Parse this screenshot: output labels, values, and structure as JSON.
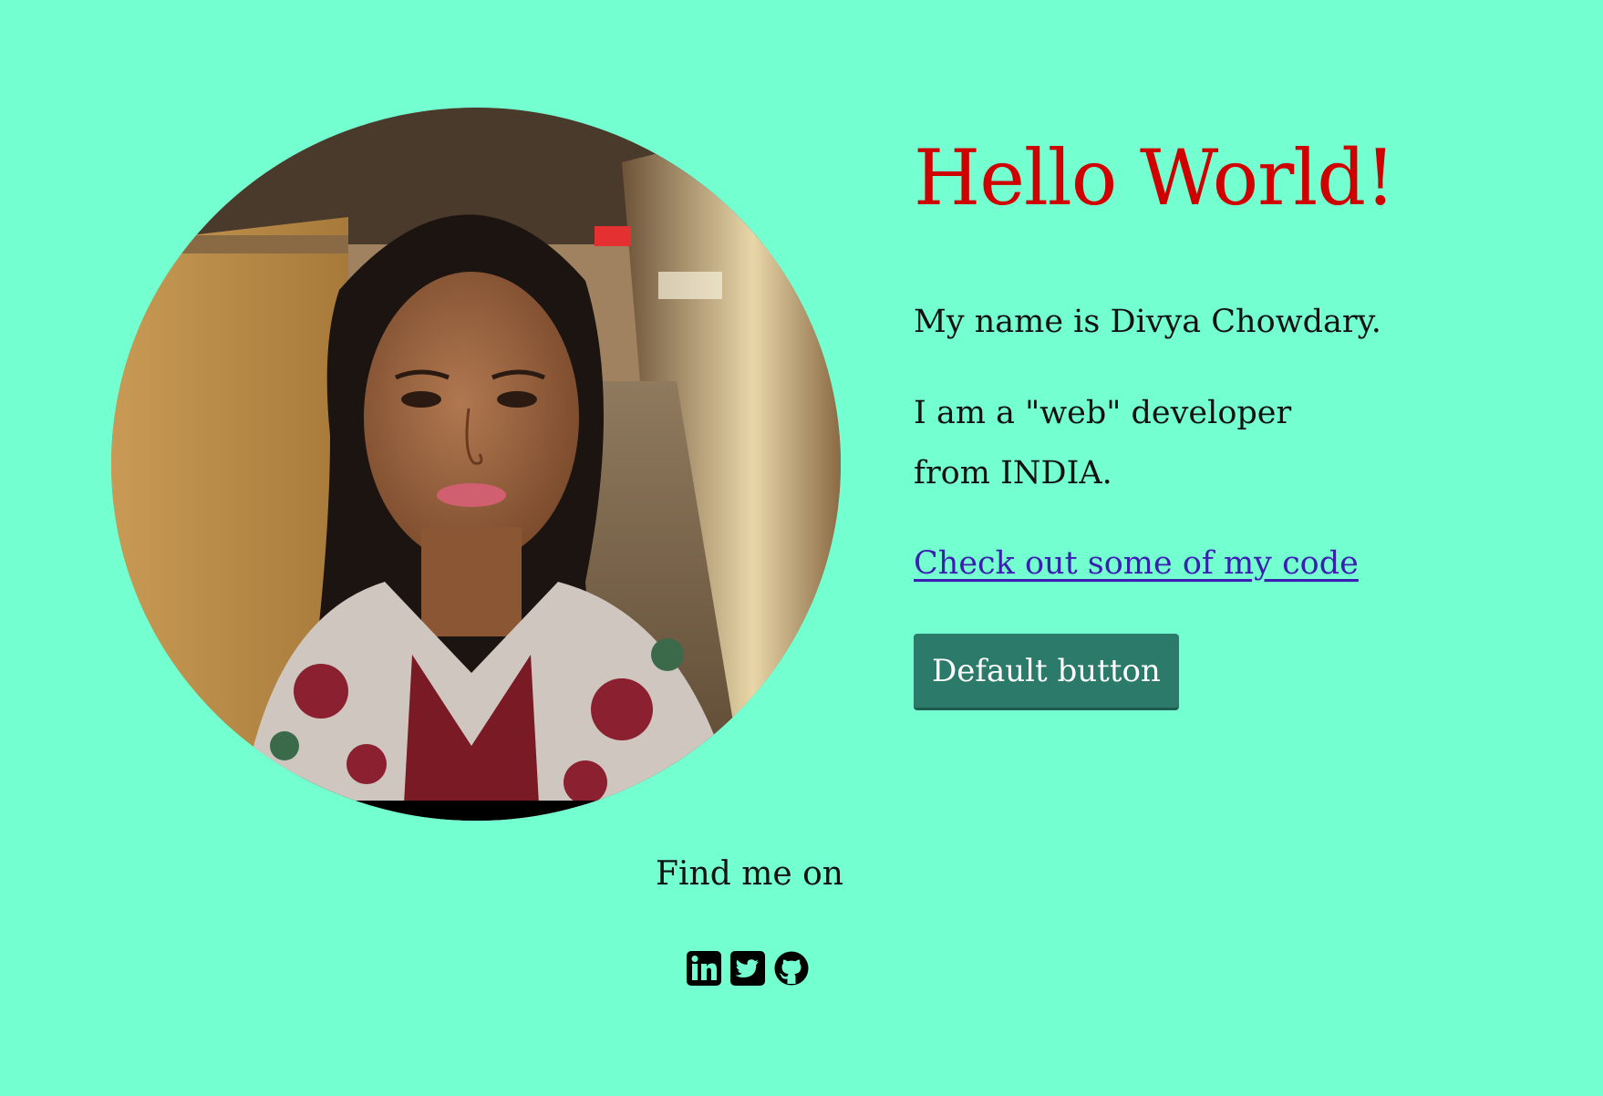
{
  "profile": {
    "photo_alt": "Divya Chowdary"
  },
  "intro": {
    "greeting": "Hello World!",
    "name_line": "My name is Divya Chowdary.",
    "dev_line": "I am a \"web\" developer from INDIA.",
    "code_link": "Check out some of my code",
    "button_label": "Default button"
  },
  "social": {
    "heading": "Find me on",
    "links": [
      {
        "icon": "linkedin-icon"
      },
      {
        "icon": "twitter-icon"
      },
      {
        "icon": "github-icon"
      }
    ]
  },
  "colors": {
    "background": "#73ffd0",
    "greeting": "#d10000",
    "link": "#3a1fb0",
    "button": "#2b7a6a"
  }
}
